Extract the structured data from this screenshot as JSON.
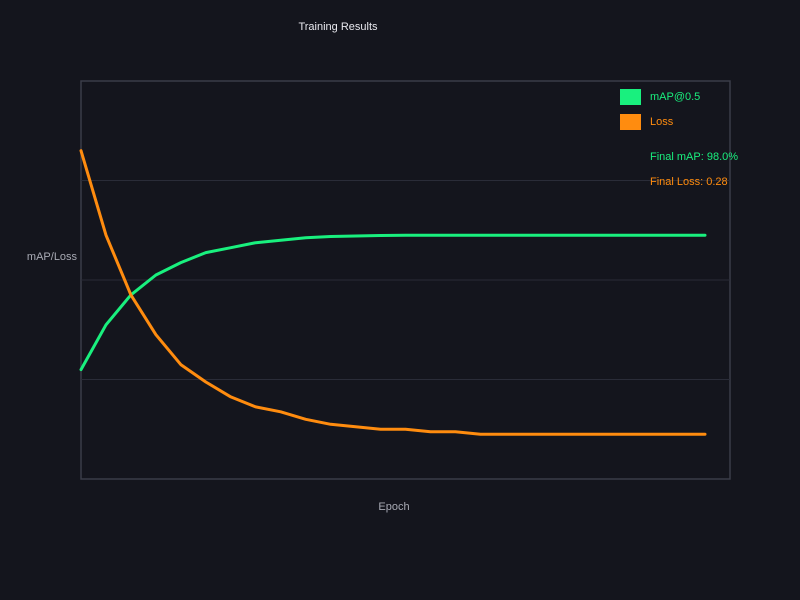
{
  "chart_data": {
    "type": "line",
    "title": "Training Results",
    "xlabel": "Epoch",
    "ylabel": "mAP/Loss",
    "grid": true,
    "legend_position": "top-right",
    "x": [
      0,
      1,
      2,
      3,
      4,
      5,
      6,
      7,
      8,
      9,
      10,
      11,
      12,
      13,
      14,
      15,
      16,
      17,
      18,
      19,
      20,
      21,
      22,
      23,
      24,
      25
    ],
    "xlim": [
      0,
      26
    ],
    "ylim": [
      0,
      1.6
    ],
    "series": [
      {
        "name": "mAP@0.5",
        "color": "#19f07e",
        "values": [
          0.44,
          0.62,
          0.74,
          0.82,
          0.87,
          0.91,
          0.93,
          0.95,
          0.96,
          0.97,
          0.975,
          0.977,
          0.979,
          0.98,
          0.98,
          0.98,
          0.98,
          0.98,
          0.98,
          0.98,
          0.98,
          0.98,
          0.98,
          0.98,
          0.98,
          0.98
        ]
      },
      {
        "name": "Loss",
        "color": "#ff8c0f",
        "values": [
          1.32,
          0.98,
          0.74,
          0.58,
          0.46,
          0.39,
          0.33,
          0.29,
          0.27,
          0.24,
          0.22,
          0.21,
          0.2,
          0.2,
          0.19,
          0.19,
          0.18,
          0.18,
          0.18,
          0.18,
          0.18,
          0.18,
          0.18,
          0.18,
          0.18,
          0.18
        ]
      }
    ],
    "annotations": [
      {
        "text": "Final mAP: 98.0%",
        "color": "#19f07e"
      },
      {
        "text": "Final Loss: 0.28",
        "color": "#ff8c0f"
      }
    ]
  },
  "colors": {
    "background": "#14151d",
    "plot_border": "#3a3c48",
    "grid": "#2a2c38",
    "text": "#e8e8ee",
    "muted_text": "#a8aab4"
  }
}
